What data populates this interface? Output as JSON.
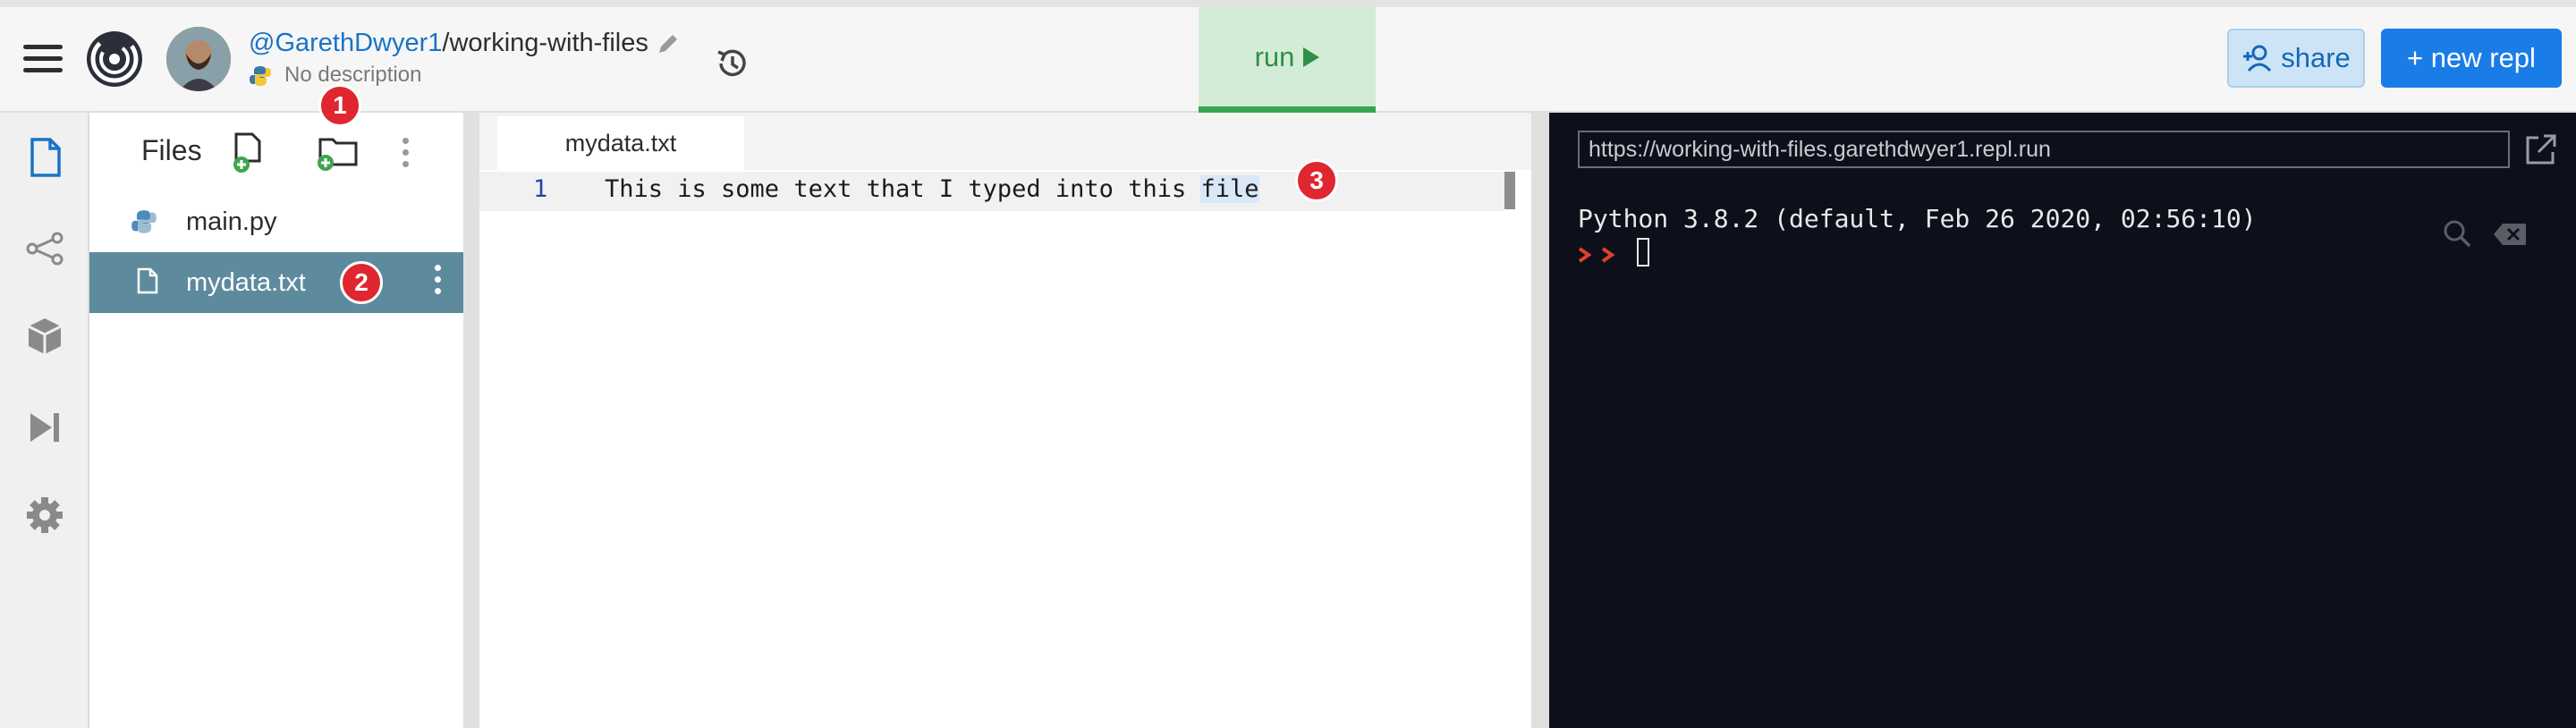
{
  "header": {
    "owner": "@GarethDwyer1",
    "separator": "/",
    "repl_name": "working-with-files",
    "description": "No description",
    "run_label": "run",
    "share_label": "share",
    "new_repl_label": "+ new repl"
  },
  "files_panel": {
    "title": "Files",
    "files": [
      {
        "name": "main.py",
        "icon": "python-file-icon"
      },
      {
        "name": "mydata.txt",
        "icon": "text-file-icon",
        "selected": true
      }
    ]
  },
  "annotations": [
    "1",
    "2",
    "3"
  ],
  "editor": {
    "tab": "mydata.txt",
    "line_number": "1",
    "code_before": "This is some text that I typed into this ",
    "code_highlight": "file"
  },
  "console": {
    "url": "https://working-with-files.garethdwyer1.repl.run",
    "python_version": "Python 3.8.2 (default, Feb 26 2020, 02:56:10)"
  },
  "colors": {
    "accent": "#1a7ce6",
    "run_green": "#36a64f",
    "selected_row": "#5e8a9e",
    "badge_red": "#e0262e",
    "console_bg": "#0d101b"
  }
}
